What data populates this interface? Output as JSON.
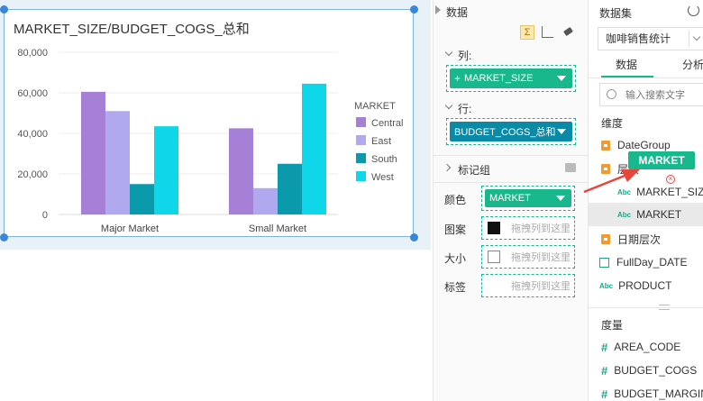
{
  "chart_data": {
    "type": "bar",
    "title": "MARKET_SIZE/BUDGET_COGS_总和",
    "categories": [
      "Major Market",
      "Small Market"
    ],
    "series": [
      {
        "name": "Central",
        "color": "#a67fd6",
        "values": [
          60500,
          42500
        ]
      },
      {
        "name": "East",
        "color": "#b1a9f0",
        "values": [
          51000,
          13000
        ]
      },
      {
        "name": "South",
        "color": "#0a9aab",
        "values": [
          15000,
          25000
        ]
      },
      {
        "name": "West",
        "color": "#0fd6e8",
        "values": [
          43500,
          64500
        ]
      }
    ],
    "y_ticks": [
      "80,000",
      "60,000",
      "40,000",
      "20,000",
      "0"
    ],
    "ylim": [
      0,
      80000
    ],
    "legend_title": "MARKET",
    "legend_position": "right"
  },
  "middle_panel": {
    "title": "数据",
    "sum_icon": "Σ",
    "columns_label": "列:",
    "columns_pill": "MARKET_SIZE",
    "rows_label": "行:",
    "rows_pill": "BUDGET_COGS_总和",
    "marks_label": "标记组",
    "color_label": "颜色",
    "color_pill": "MARKET",
    "pattern_label": "图案",
    "size_label": "大小",
    "tag_label": "标签",
    "drop_hint": "拖拽列到这里"
  },
  "right_panel": {
    "dataset_title": "数据集",
    "dataset_select": "咖啡销售统计",
    "tab_data": "数据",
    "tab_analysis": "分析",
    "search_placeholder": "输入搜索文字",
    "dimension_title": "维度",
    "dimensions": [
      "DateGroup",
      "层次",
      "MARKET_SIZE",
      "MARKET",
      "日期层次",
      "FullDay_DATE",
      "PRODUCT"
    ],
    "measure_title": "度量",
    "measures": [
      "AREA_CODE",
      "BUDGET_COGS",
      "BUDGET_MARGIN"
    ],
    "drag_tooltip": "MARKET"
  },
  "colors": {
    "accent_green": "#19b88c",
    "accent_teal": "#0b8aa7",
    "selection_blue": "#3a86d9",
    "arrow_red": "#e8453c"
  }
}
